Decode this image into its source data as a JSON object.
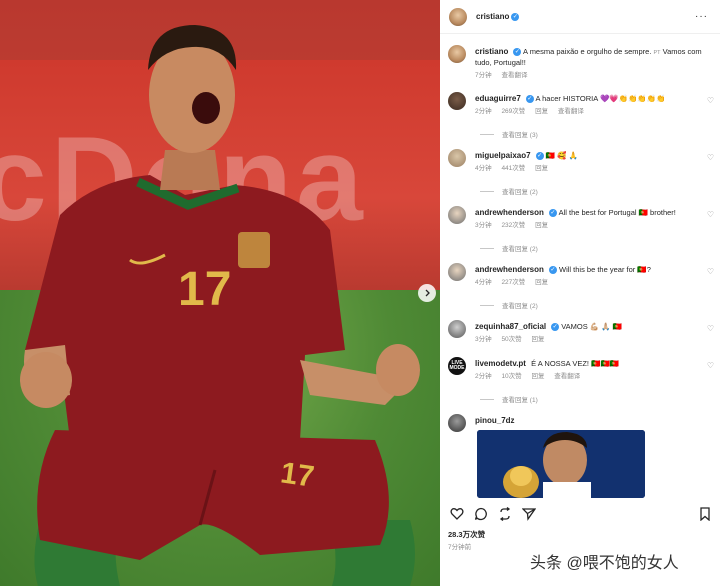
{
  "post": {
    "author": "cristiano",
    "caption_author": "cristiano",
    "caption_text": "A mesma paixão e orgulho de sempre.",
    "caption_lang": "PT",
    "caption_text_2": "Vamos com tudo, Portugal!!",
    "caption_time": "7分钟",
    "caption_translate": "查看翻译",
    "jersey_number": "17",
    "banner_text": "cDona"
  },
  "comments": [
    {
      "user": "eduaguirre7",
      "verified": true,
      "text": "A hacer HISTORIA 💜💗👏👏👏👏👏",
      "time": "2分钟",
      "likes": "269次赞",
      "reply": "回复",
      "translate": "查看翻译",
      "replies": "查看回复 (3)"
    },
    {
      "user": "miguelpaixao7",
      "verified": true,
      "text": "🇵🇹 🥰 🙏",
      "time": "4分钟",
      "likes": "441次赞",
      "reply": "回复",
      "translate": "",
      "replies": "查看回复 (2)"
    },
    {
      "user": "andrewhenderson",
      "verified": true,
      "text": "All the best for Portugal 🇵🇹 brother!",
      "time": "3分钟",
      "likes": "232次赞",
      "reply": "回复",
      "translate": "",
      "replies": "查看回复 (2)"
    },
    {
      "user": "andrewhenderson",
      "verified": true,
      "text": "Will this be the year for 🇵🇹?",
      "time": "4分钟",
      "likes": "227次赞",
      "reply": "回复",
      "translate": "",
      "replies": "查看回复 (2)"
    },
    {
      "user": "zequinha87_oficial",
      "verified": true,
      "text": "VAMOS 💪🏼 🙏🏼 🇵🇹",
      "time": "3分钟",
      "likes": "50次赞",
      "reply": "回复",
      "translate": "",
      "replies": ""
    },
    {
      "user": "livemodetv.pt",
      "verified": false,
      "text": "É A NOSSA VEZ! 🇵🇹🇵🇹🇵🇹",
      "time": "2分钟",
      "likes": "10次赞",
      "reply": "回复",
      "translate": "查看翻译",
      "replies": "查看回复 (1)"
    },
    {
      "user": "pinou_7dz",
      "verified": false,
      "text": "",
      "time": "",
      "likes": "",
      "reply": "",
      "translate": "",
      "replies": ""
    }
  ],
  "livemode_avatar_text": "LIVE MODE",
  "footer": {
    "likes": "28.3万次赞",
    "time": "7分钟前"
  },
  "watermark": "头条 @喂不饱的女人",
  "icons": {
    "more": "more-dots-icon",
    "heart": "heart-icon",
    "comment": "comment-icon",
    "share": "share-icon",
    "send": "send-icon",
    "bookmark": "bookmark-icon",
    "next": "chevron-right-icon"
  },
  "colors": {
    "verified": "#3897f0",
    "jersey": "#8d1a1f",
    "grass": "#4f8a35"
  }
}
